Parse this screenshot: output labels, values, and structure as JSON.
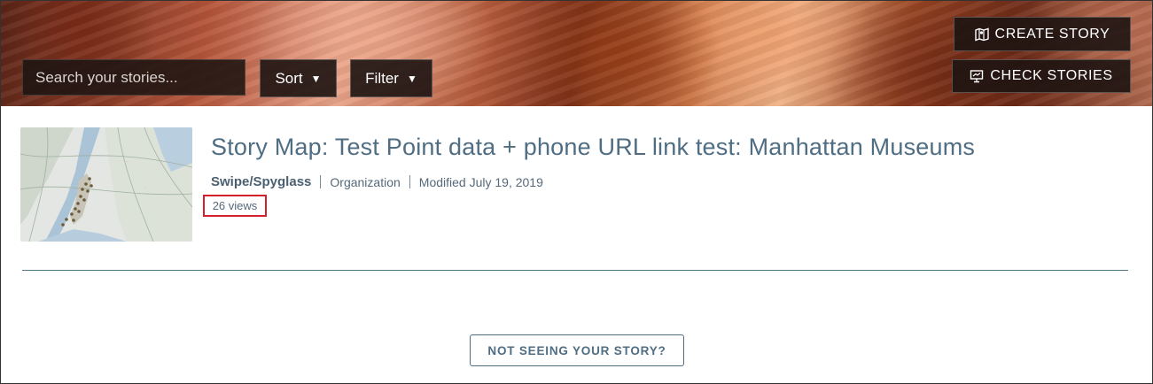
{
  "header": {
    "search": {
      "placeholder": "Search your stories..."
    },
    "sort_label": "Sort",
    "filter_label": "Filter",
    "caret": "▼",
    "create_story_label": "CREATE STORY",
    "check_stories_label": "CHECK STORIES",
    "create_icon": "map-icon",
    "check_icon": "presentation-icon"
  },
  "story": {
    "title": "Story Map: Test Point data + phone URL link test: Manhattan Museums",
    "type": "Swipe/Spyglass",
    "sharing": "Organization",
    "modified": "Modified July 19, 2019",
    "views": "26 views",
    "thumbnail": "map-thumbnail"
  },
  "footer": {
    "not_seeing_label": "NOT SEEING YOUR STORY?"
  },
  "colors": {
    "accent": "#4f6d83",
    "highlight_border": "#d3202a",
    "divider": "#4e7a8a"
  }
}
